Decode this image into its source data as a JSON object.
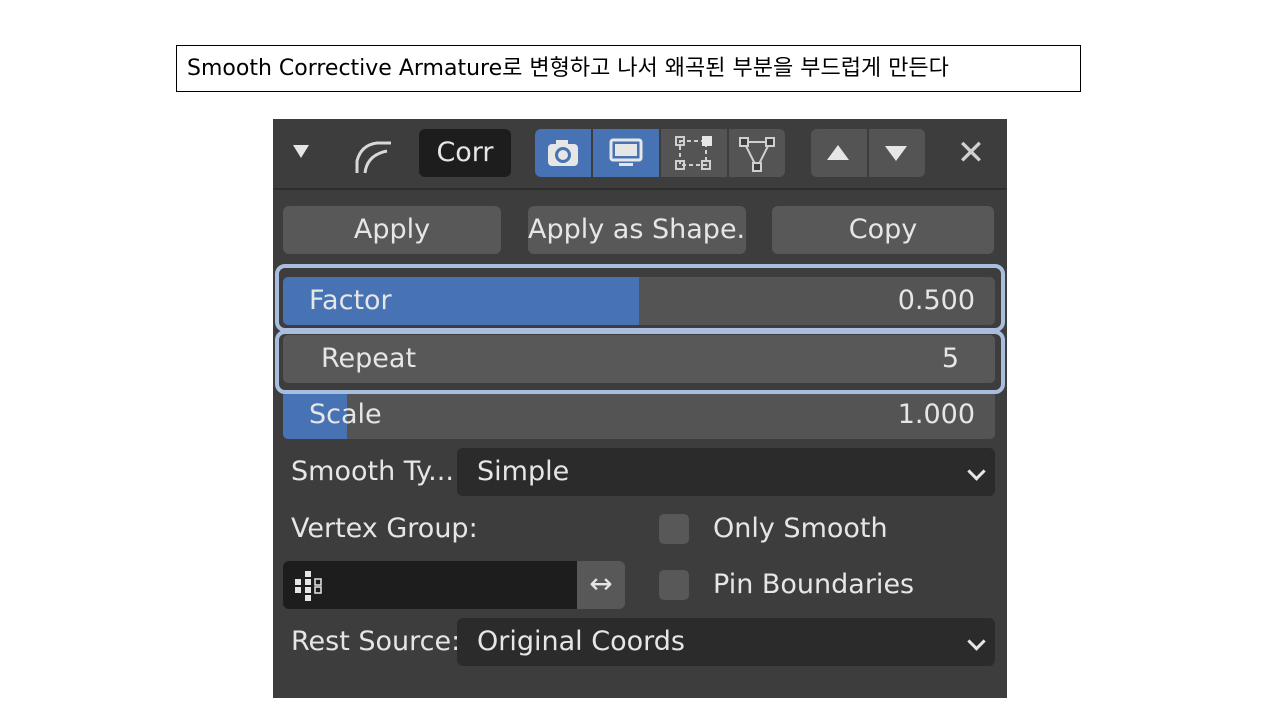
{
  "caption": "Smooth Corrective Armature로 변형하고 나서 왜곡된 부분을 부드럽게 만든다",
  "header": {
    "collapse_icon": "triangle-down-icon",
    "modifier_icon": "corrective-smooth-icon",
    "name": "Corr",
    "toggles": [
      {
        "icon": "camera-icon",
        "active": true
      },
      {
        "icon": "monitor-icon",
        "active": true
      },
      {
        "icon": "editmode-icon",
        "active": false
      },
      {
        "icon": "cage-vertex-icon",
        "active": false
      }
    ],
    "move_up_icon": "arrow-up-icon",
    "move_down_icon": "arrow-down-icon",
    "close_label": "✕"
  },
  "buttons": {
    "apply": "Apply",
    "apply_shape": "Apply as Shape...",
    "copy": "Copy"
  },
  "fields": {
    "factor": {
      "label": "Factor",
      "value": "0.500",
      "fill_fraction": 0.5
    },
    "repeat": {
      "label": "Repeat",
      "value": "5"
    },
    "scale": {
      "label": "Scale",
      "value": "1.000",
      "fill_fraction": 0.09
    }
  },
  "smooth_type": {
    "label": "Smooth Ty...",
    "value": "Simple"
  },
  "vertex_group": {
    "label": "Vertex Group:",
    "value": "",
    "swap_label": "↔"
  },
  "only_smooth": {
    "label": "Only Smooth",
    "checked": false
  },
  "pin_boundaries": {
    "label": "Pin Boundaries",
    "checked": false
  },
  "rest_source": {
    "label": "Rest Source:",
    "value": "Original Coords"
  },
  "colors": {
    "accent": "#4772b3",
    "panel_bg": "#3d3d3d",
    "highlight": "#a9bede"
  }
}
